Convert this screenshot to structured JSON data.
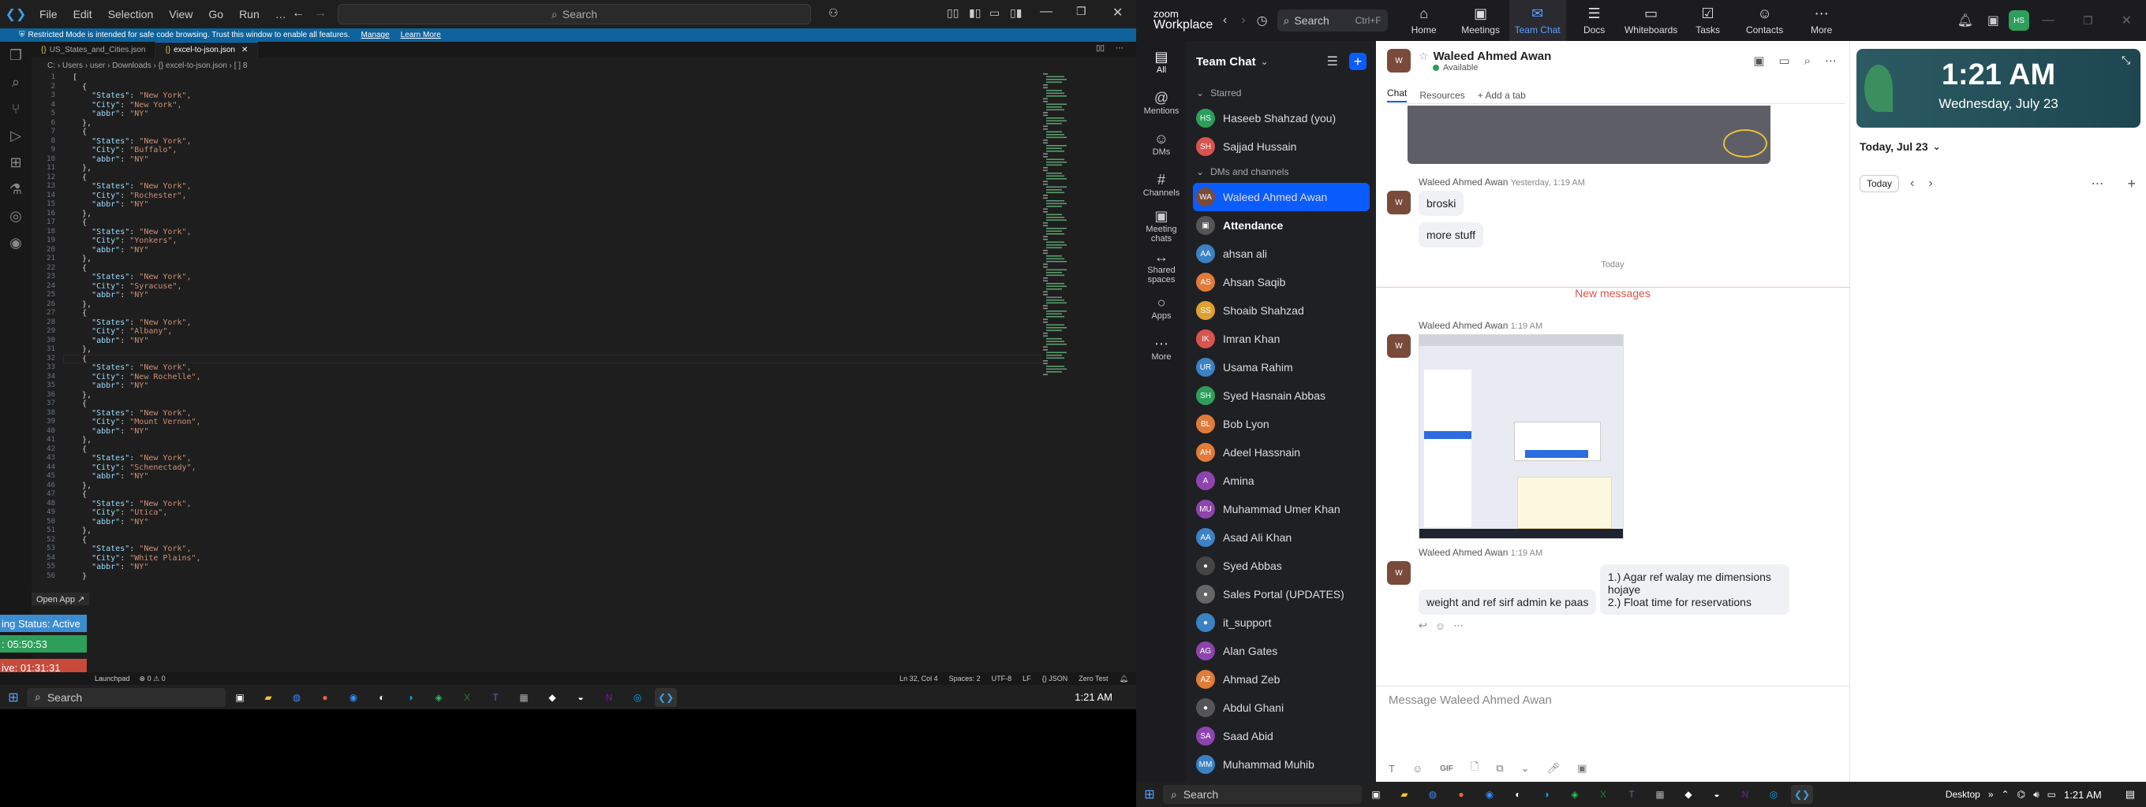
{
  "vscode": {
    "menus": [
      "File",
      "Edit",
      "Selection",
      "View",
      "Go",
      "Run",
      "…"
    ],
    "search_placeholder": "Search",
    "restricted": {
      "text": "Restricted Mode is intended for safe code browsing. Trust this window to enable all features.",
      "manage": "Manage",
      "learn": "Learn More"
    },
    "tabs": [
      "US_States_and_Cities.json",
      "excel-to-json.json"
    ],
    "breadcrumb": "C: › Users › user › Downloads › {} excel-to-json.json › [ ] 8",
    "records": [
      {
        "city": "New York"
      },
      {
        "city": "Buffalo"
      },
      {
        "city": "Rochester"
      },
      {
        "city": "Yonkers"
      },
      {
        "city": "Syracuse"
      },
      {
        "city": "Albany"
      },
      {
        "city": "New Rochelle"
      },
      {
        "city": "Mount Vernon"
      },
      {
        "city": "Schenectady"
      },
      {
        "city": "Utica"
      },
      {
        "city": "White Plains"
      }
    ],
    "state": "New York",
    "abbr": "NY",
    "status": {
      "position": "Ln 32, Col 4",
      "spaces": "Spaces: 2",
      "encoding": "UTF-8",
      "eol": "LF",
      "lang": "{} JSON",
      "extra": "Zero Test",
      "left": "⊗ 0 ⚠ 0",
      "launchpad": "Launchpad"
    },
    "open_app": "Open App ↗",
    "overlay": {
      "status": "ing Status: Active",
      "timer1": ": 05:50:53",
      "timer2": "ive: 01:31:31"
    },
    "taskbar_search": "Search",
    "clock": "1:21 AM"
  },
  "zoom": {
    "brand_top": "zoom",
    "brand": "Workplace",
    "search": "Search",
    "search_shortcut": "Ctrl+F",
    "tabs": [
      {
        "label": "Home",
        "icon": "home-icon",
        "glyph": "⌂"
      },
      {
        "label": "Meetings",
        "icon": "video-icon",
        "glyph": "▣"
      },
      {
        "label": "Team Chat",
        "icon": "chat-icon",
        "glyph": "✉"
      },
      {
        "label": "Docs",
        "icon": "doc-icon",
        "glyph": "☰"
      },
      {
        "label": "Whiteboards",
        "icon": "whiteboard-icon",
        "glyph": "▭"
      },
      {
        "label": "Tasks",
        "icon": "tasks-icon",
        "glyph": "☑"
      },
      {
        "label": "Contacts",
        "icon": "contacts-icon",
        "glyph": "☺"
      },
      {
        "label": "More",
        "icon": "more-icon",
        "glyph": "⋯"
      }
    ],
    "user_initials": "HS",
    "left_nav": [
      {
        "label": "All",
        "glyph": "▤"
      },
      {
        "label": "Mentions",
        "glyph": "@"
      },
      {
        "label": "DMs",
        "glyph": "☺"
      },
      {
        "label": "Channels",
        "glyph": "#"
      },
      {
        "label": "Meeting chats",
        "glyph": "▣"
      },
      {
        "label": "Shared spaces",
        "glyph": "↔"
      },
      {
        "label": "Apps",
        "glyph": "○"
      },
      {
        "label": "More",
        "glyph": "⋯"
      }
    ],
    "list_title": "Team Chat",
    "starred_header": "Starred",
    "dms_header": "DMs and channels",
    "starred": [
      {
        "initials": "HS",
        "name": "Haseeb Shahzad (you)",
        "color": "#2e9e5b"
      },
      {
        "initials": "SH",
        "name": "Sajjad Hussain",
        "color": "#d9534f"
      }
    ],
    "contacts": [
      {
        "initials": "WA",
        "name": "Waleed Ahmed Awan",
        "color": "#7a4b3a"
      },
      {
        "initials": "▣",
        "name": "Attendance",
        "color": "#555"
      },
      {
        "initials": "AA",
        "name": "ahsan ali",
        "color": "#3b82c4"
      },
      {
        "initials": "AS",
        "name": "Ahsan Saqib",
        "color": "#e07b39"
      },
      {
        "initials": "SS",
        "name": "Shoaib Shahzad",
        "color": "#e0a030"
      },
      {
        "initials": "IK",
        "name": "Imran Khan",
        "color": "#d9534f"
      },
      {
        "initials": "UR",
        "name": "Usama Rahim",
        "color": "#3b82c4"
      },
      {
        "initials": "SH",
        "name": "Syed Hasnain Abbas",
        "color": "#2e9e5b"
      },
      {
        "initials": "BL",
        "name": "Bob Lyon",
        "color": "#e07b39"
      },
      {
        "initials": "AH",
        "name": "Adeel Hassnain",
        "color": "#e07b39"
      },
      {
        "initials": "A",
        "name": "Amina",
        "color": "#8e44ad"
      },
      {
        "initials": "MU",
        "name": "Muhammad Umer Khan",
        "color": "#8e44ad"
      },
      {
        "initials": "AA",
        "name": "Asad Ali Khan",
        "color": "#3b82c4"
      },
      {
        "initials": "●",
        "name": "Syed Abbas",
        "color": "#444"
      },
      {
        "initials": "●",
        "name": "Sales Portal (UPDATES)",
        "color": "#666"
      },
      {
        "initials": "●",
        "name": "it_support",
        "color": "#3b82c4"
      },
      {
        "initials": "AG",
        "name": "Alan Gates",
        "color": "#8e44ad"
      },
      {
        "initials": "AZ",
        "name": "Ahmad Zeb",
        "color": "#e07b39"
      },
      {
        "initials": "●",
        "name": "Abdul Ghani",
        "color": "#555"
      },
      {
        "initials": "SA",
        "name": "Saad Abid",
        "color": "#8e44ad"
      },
      {
        "initials": "MM",
        "name": "Muhammad Muhib",
        "color": "#3b82c4"
      }
    ],
    "chat": {
      "title": "Waleed Ahmed Awan",
      "status": "Available",
      "subtabs": [
        "Chat",
        "Resources",
        "+ Add a tab"
      ],
      "msg1_name": "Waleed Ahmed Awan",
      "msg1_time": "Yesterday, 1:19 AM",
      "msg1_lines": [
        "broski",
        "more stuff"
      ],
      "today": "Today",
      "new_messages": "New messages",
      "msg2_name": "Waleed Ahmed Awan",
      "msg2_time": "1:19 AM",
      "msg3_name": "Waleed Ahmed Awan",
      "msg3_time": "1:19 AM",
      "msg3_lines": [
        "weight and ref sirf admin ke paas",
        "1.) Agar ref walay me dimensions hojaye",
        "2.) Float time for reservations"
      ],
      "composer": "Message Waleed Ahmed Awan"
    },
    "calendar": {
      "time": "1:21 AM",
      "date": "Wednesday, July 23",
      "today_label": "Today, Jul 23",
      "today_btn": "Today"
    },
    "taskbar_search": "Search",
    "desktop": "Desktop",
    "clock": "1:21 AM"
  }
}
